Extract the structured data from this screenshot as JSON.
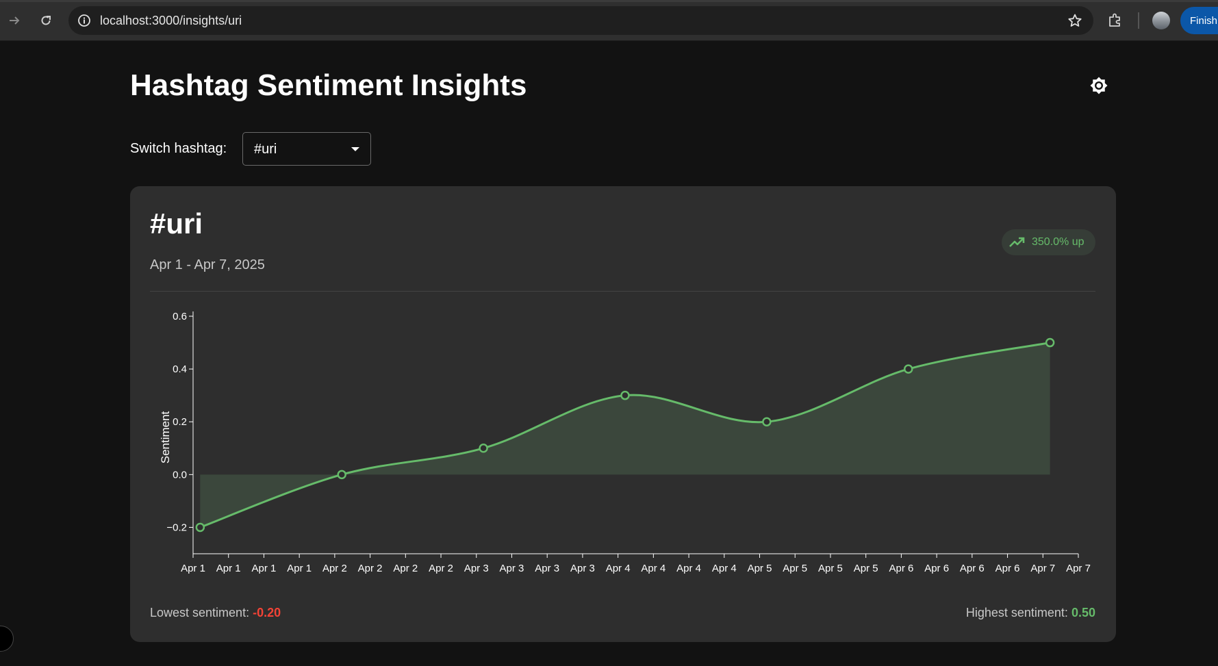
{
  "browser": {
    "url": "localhost:3000/insights/uri",
    "finish_label": "Finish"
  },
  "page": {
    "title": "Hashtag Sentiment Insights",
    "switch_label": "Switch hashtag:",
    "selected_hashtag": "#uri"
  },
  "card": {
    "hashtag": "#uri",
    "date_range": "Apr 1 - Apr 7, 2025",
    "trend_text": "350.0% up",
    "lowest_label": "Lowest sentiment:",
    "lowest_value": "-0.20",
    "highest_label": "Highest sentiment:",
    "highest_value": "0.50"
  },
  "colors": {
    "line": "#66bb6a",
    "area": "#3d4a3e",
    "negative": "#f44336"
  },
  "chart_data": {
    "type": "area",
    "ylabel": "Sentiment",
    "xlabel": "",
    "ylim": [
      -0.3,
      0.6
    ],
    "y_ticks": [
      "0.6",
      "0.4",
      "0.2",
      "0.0",
      "−0.2"
    ],
    "y_tick_values": [
      0.6,
      0.4,
      0.2,
      0.0,
      -0.2
    ],
    "x_ticks": [
      "Apr 1",
      "Apr 1",
      "Apr 1",
      "Apr 1",
      "Apr 2",
      "Apr 2",
      "Apr 2",
      "Apr 2",
      "Apr 3",
      "Apr 3",
      "Apr 3",
      "Apr 3",
      "Apr 4",
      "Apr 4",
      "Apr 4",
      "Apr 4",
      "Apr 5",
      "Apr 5",
      "Apr 5",
      "Apr 5",
      "Apr 6",
      "Apr 6",
      "Apr 6",
      "Apr 6",
      "Apr 7",
      "Apr 7"
    ],
    "x_range_days": [
      0,
      6.25
    ],
    "series": [
      {
        "x": [
          "Apr 1",
          "Apr 2",
          "Apr 3",
          "Apr 4",
          "Apr 5",
          "Apr 6",
          "Apr 7"
        ],
        "x_days": [
          0.05,
          1.05,
          2.05,
          3.05,
          4.05,
          5.05,
          6.05
        ],
        "values": [
          -0.2,
          0.0,
          0.1,
          0.3,
          0.2,
          0.4,
          0.5
        ]
      }
    ],
    "grid": false,
    "legend": "none"
  }
}
